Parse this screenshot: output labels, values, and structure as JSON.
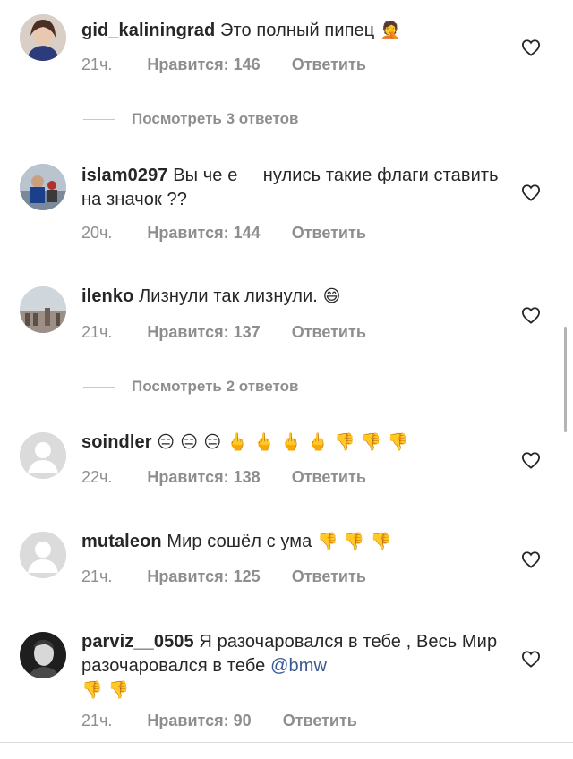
{
  "comments": [
    {
      "username": "gid_kaliningrad",
      "text": "Это полный пипец",
      "emoji": "🤦",
      "time": "21ч.",
      "likes": "Нравится: 146",
      "reply": "Ответить",
      "view_replies": "Посмотреть 3 ответов"
    },
    {
      "username": "islam0297",
      "text": "Вы че е     нулись такие флаги ставить на значок ??",
      "time": "20ч.",
      "likes": "Нравится: 144",
      "reply": "Ответить"
    },
    {
      "username": "ilenko",
      "text": "Лизнули так лизнули.",
      "emoji": "😄",
      "time": "21ч.",
      "likes": "Нравится: 137",
      "reply": "Ответить",
      "view_replies": "Посмотреть 2 ответов"
    },
    {
      "username": "soindler",
      "emoji": "😑 😑 😑 🖕 🖕 🖕 🖕 👎 👎 👎",
      "time": "22ч.",
      "likes": "Нравится: 138",
      "reply": "Ответить"
    },
    {
      "username": "mutaleon",
      "text": "Мир сошёл с ума",
      "emoji": "👎 👎 👎",
      "time": "21ч.",
      "likes": "Нравится: 125",
      "reply": "Ответить"
    },
    {
      "username": "parviz__0505",
      "text": "Я разочаровался в тебе , Весь Мир разочаровался в тебе",
      "mention": "@bmw",
      "emoji": "👎 👎",
      "time": "21ч.",
      "likes": "Нравится: 90",
      "reply": "Ответить"
    }
  ],
  "icons": {
    "like": "heart-icon",
    "default_avatar": "default-avatar-icon"
  },
  "colors": {
    "text": "#262626",
    "secondary": "#8e8e8e",
    "mention": "#385a93",
    "divider": "#dbdbdb"
  }
}
